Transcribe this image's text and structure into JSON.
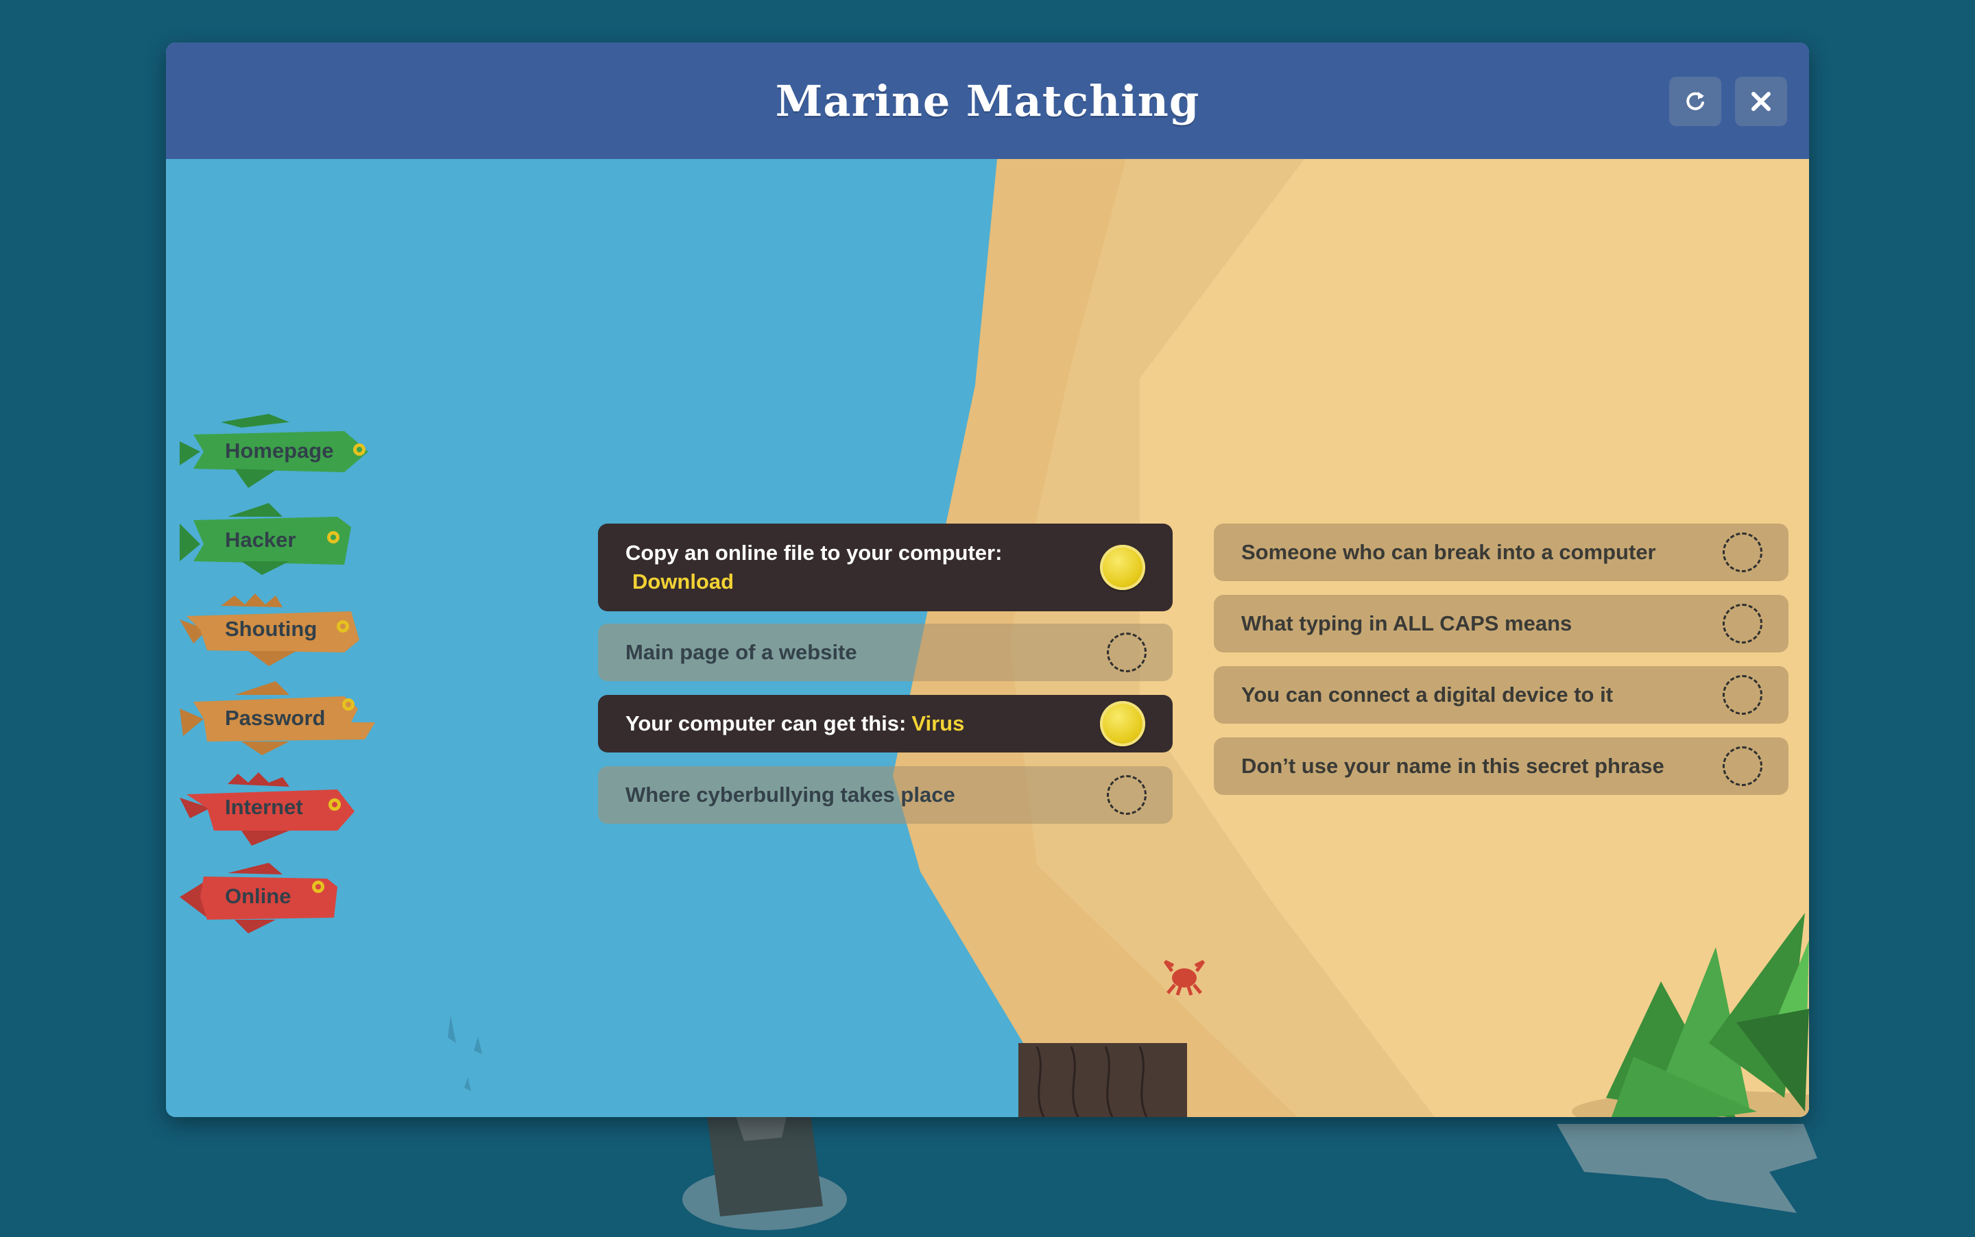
{
  "game": {
    "title": "Marine Matching",
    "refresh_icon": "refresh-icon",
    "close_icon": "close-icon"
  },
  "colors": {
    "background": "#135a73",
    "titlebar": "#3c5f9c",
    "water": "#4eaed3",
    "sand": "#f2cf8d",
    "wet_sand": "#e4bb78",
    "matched_card": "#362c2d",
    "answer_text": "#f3d335",
    "fish_green": "#3da14a",
    "fish_orange": "#d28f45",
    "fish_red": "#d8453e"
  },
  "word_fish": [
    {
      "label": "Homepage",
      "color": "green"
    },
    {
      "label": "Hacker",
      "color": "green"
    },
    {
      "label": "Shouting",
      "color": "orange"
    },
    {
      "label": "Password",
      "color": "orange"
    },
    {
      "label": "Internet",
      "color": "red"
    },
    {
      "label": "Online",
      "color": "red"
    }
  ],
  "clues_left": [
    {
      "text": "Copy an online file to your computer:",
      "answer": "Download",
      "matched": true
    },
    {
      "text": "Main page of a website",
      "answer": "",
      "matched": false
    },
    {
      "text": "Your computer can get this:",
      "answer": "Virus",
      "matched": true
    },
    {
      "text": "Where cyberbullying takes place",
      "answer": "",
      "matched": false
    }
  ],
  "clues_right": [
    {
      "text": "Someone who can break into a computer",
      "matched": false
    },
    {
      "text": "What typing in ALL CAPS means",
      "matched": false
    },
    {
      "text": "You can connect a digital device to it",
      "matched": false
    },
    {
      "text": "Don’t use your name in this secret phrase",
      "matched": false
    }
  ]
}
